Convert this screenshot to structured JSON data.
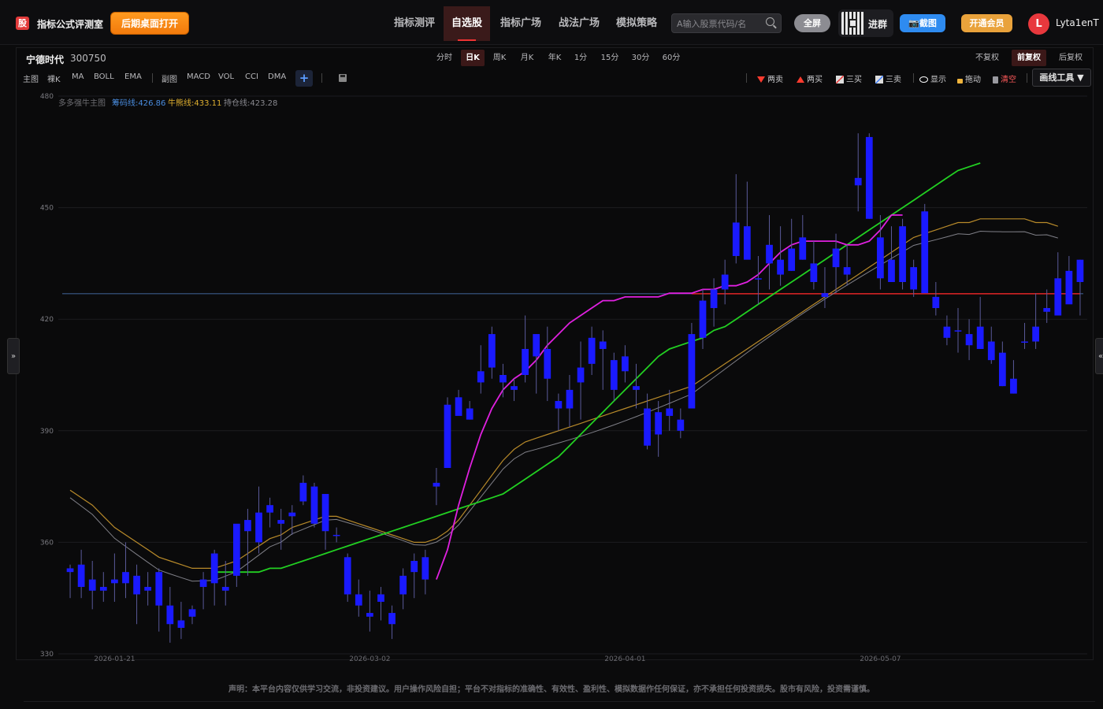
{
  "app": {
    "logo_char": "股",
    "title": "指标公式评测室",
    "open_desktop_label": "后期桌面打开"
  },
  "nav": {
    "items": [
      {
        "label": "指标测评",
        "active": false
      },
      {
        "label": "自选股",
        "active": true
      },
      {
        "label": "指标广场",
        "active": false
      },
      {
        "label": "战法广场",
        "active": false
      },
      {
        "label": "模拟策略",
        "active": false
      }
    ],
    "search_placeholder": "A输入股票代码/名",
    "fullscreen_label": "全屏",
    "group_label": "进群",
    "screenshot_label": "📷截图",
    "vip_label": "开通会员",
    "avatar_letter": "L",
    "username": "Lyta1enT"
  },
  "stock": {
    "name": "宁德时代",
    "code": "300750"
  },
  "periods": [
    {
      "label": "分时",
      "active": false
    },
    {
      "label": "日K",
      "active": true
    },
    {
      "label": "周K",
      "active": false
    },
    {
      "label": "月K",
      "active": false
    },
    {
      "label": "年K",
      "active": false
    },
    {
      "label": "1分",
      "active": false
    },
    {
      "label": "15分",
      "active": false
    },
    {
      "label": "30分",
      "active": false
    },
    {
      "label": "60分",
      "active": false
    }
  ],
  "adjust": [
    {
      "label": "不复权",
      "active": false
    },
    {
      "label": "前复权",
      "active": true
    },
    {
      "label": "后复权",
      "active": false
    }
  ],
  "indicators": {
    "main": [
      "主图",
      "裸K",
      "MA",
      "BOLL",
      "EMA"
    ],
    "sub": [
      "副图",
      "MACD",
      "VOL",
      "CCI",
      "DMA"
    ],
    "plus": "+"
  },
  "tools": {
    "sell2": "两卖",
    "buy2": "两买",
    "buy3": "三买",
    "sell3": "三卖",
    "show": "显示",
    "drag": "拖动",
    "clear": "清空",
    "draw_tools": "画线工具 ▼"
  },
  "legend": {
    "title": "多多强牛主图",
    "chip_label": "筹码线:426.86",
    "bull_label": "牛熊线:433.11",
    "hold_label": "持仓线:423.28"
  },
  "colors": {
    "candle_up": "#1a1aff",
    "candle_down": "#1a1aff",
    "wick": "#5a5a9a",
    "magenta_line": "#e020e0",
    "green_line": "#22d022",
    "gold_line": "#b88a2a",
    "gray_line": "#808088",
    "blue_hline": "#3a5a8a",
    "red_hline": "#e02020"
  },
  "chart_data": {
    "type": "candlestick",
    "ylim": [
      330,
      480
    ],
    "yticks": [
      330,
      360,
      390,
      420,
      450,
      480
    ],
    "xtick_labels": [
      {
        "index": 4,
        "label": "2026-01-21"
      },
      {
        "index": 27,
        "label": "2026-03-02"
      },
      {
        "index": 50,
        "label": "2026-04-01"
      },
      {
        "index": 73,
        "label": "2026-05-07"
      }
    ],
    "chip_line": 426.86,
    "red_line": 426.86,
    "candles": [
      [
        353,
        354,
        345,
        352
      ],
      [
        348,
        358,
        345,
        354
      ],
      [
        350,
        355,
        342,
        347
      ],
      [
        347,
        352,
        344,
        348
      ],
      [
        349,
        357,
        344,
        350
      ],
      [
        352,
        360,
        345,
        349
      ],
      [
        346,
        354,
        338,
        351
      ],
      [
        347,
        352,
        343,
        348
      ],
      [
        352,
        353,
        336,
        343
      ],
      [
        343,
        348,
        333,
        338
      ],
      [
        339,
        344,
        334,
        337
      ],
      [
        342,
        343,
        338,
        340
      ],
      [
        350,
        352,
        342,
        348
      ],
      [
        349,
        358,
        343,
        357
      ],
      [
        347,
        355,
        343,
        348
      ],
      [
        351,
        363,
        348,
        365
      ],
      [
        366,
        369,
        351,
        363
      ],
      [
        368,
        375,
        357,
        360
      ],
      [
        370,
        372,
        364,
        368
      ],
      [
        366,
        369,
        358,
        365
      ],
      [
        368,
        370,
        362,
        367
      ],
      [
        376,
        378,
        370,
        371
      ],
      [
        375,
        376,
        364,
        365
      ],
      [
        373,
        373,
        358,
        363
      ],
      [
        362,
        364,
        360,
        362
      ],
      [
        356,
        357,
        344,
        346
      ],
      [
        346,
        350,
        340,
        343
      ],
      [
        341,
        347,
        336,
        340
      ],
      [
        344,
        348,
        339,
        346
      ],
      [
        341,
        343,
        334,
        338
      ],
      [
        351,
        353,
        342,
        346
      ],
      [
        352,
        357,
        345,
        355
      ],
      [
        356,
        358,
        346,
        350
      ],
      [
        376,
        380,
        370,
        375
      ],
      [
        397,
        399,
        380,
        380
      ],
      [
        399,
        401,
        395,
        394
      ],
      [
        396,
        398,
        393,
        393
      ],
      [
        403,
        413,
        400,
        406
      ],
      [
        407,
        418,
        404,
        416
      ],
      [
        405,
        408,
        399,
        403
      ],
      [
        402,
        404,
        398,
        401
      ],
      [
        412,
        421,
        403,
        405
      ],
      [
        410,
        416,
        400,
        416
      ],
      [
        412,
        418,
        398,
        404
      ],
      [
        398,
        400,
        390,
        396
      ],
      [
        401,
        405,
        391,
        396
      ],
      [
        403,
        414,
        393,
        407
      ],
      [
        415,
        418,
        405,
        408
      ],
      [
        412,
        417,
        401,
        414
      ],
      [
        409,
        411,
        398,
        401
      ],
      [
        410,
        413,
        403,
        406
      ],
      [
        402,
        408,
        396,
        401
      ],
      [
        396,
        400,
        385,
        386
      ],
      [
        395,
        398,
        383,
        389
      ],
      [
        396,
        401,
        390,
        394
      ],
      [
        393,
        396,
        388,
        390
      ],
      [
        416,
        419,
        396,
        396
      ],
      [
        425,
        428,
        412,
        415
      ],
      [
        428,
        431,
        418,
        423
      ],
      [
        432,
        436,
        424,
        428
      ],
      [
        446,
        459,
        435,
        437
      ],
      [
        445,
        457,
        440,
        436
      ],
      [
        431,
        437,
        424,
        431
      ],
      [
        440,
        448,
        428,
        435
      ],
      [
        436,
        445,
        429,
        432
      ],
      [
        439,
        447,
        433,
        433
      ],
      [
        442,
        448,
        436,
        436
      ],
      [
        435,
        441,
        428,
        430
      ],
      [
        426,
        434,
        423,
        427
      ],
      [
        439,
        443,
        427,
        434
      ],
      [
        432,
        440,
        429,
        434
      ],
      [
        458,
        470,
        449,
        456
      ],
      [
        469,
        470,
        447,
        447
      ],
      [
        442,
        448,
        428,
        431
      ],
      [
        436,
        445,
        431,
        430
      ],
      [
        445,
        447,
        428,
        430
      ],
      [
        428,
        436,
        426,
        434
      ],
      [
        449,
        451,
        428,
        427
      ],
      [
        426,
        430,
        421,
        423
      ],
      [
        418,
        421,
        413,
        415
      ],
      [
        417,
        423,
        411,
        417
      ],
      [
        416,
        420,
        409,
        413
      ],
      [
        418,
        426,
        412,
        412
      ],
      [
        414,
        418,
        408,
        409
      ],
      [
        411,
        414,
        402,
        402
      ],
      [
        404,
        409,
        400,
        400
      ],
      [
        414,
        419,
        412,
        414
      ],
      [
        418,
        427,
        412,
        414
      ],
      [
        422,
        428,
        419,
        423
      ],
      [
        431,
        438,
        424,
        421
      ],
      [
        433,
        437,
        425,
        424
      ],
      [
        436,
        436,
        421,
        430
      ]
    ],
    "series": [
      {
        "name": "magenta",
        "start": 33,
        "values": [
          350,
          358,
          370,
          380,
          389,
          396,
          401,
          404,
          406,
          409,
          413,
          416,
          419,
          421,
          423,
          425,
          425,
          426,
          426,
          426,
          426,
          427,
          427,
          427,
          428,
          428,
          429,
          429,
          430,
          432,
          435,
          438,
          440,
          441,
          441,
          441,
          441,
          440,
          440,
          441,
          444,
          448,
          448
        ]
      },
      {
        "name": "green_full",
        "start": 13,
        "values": [
          352,
          352,
          352,
          352,
          352,
          353,
          353,
          354,
          355,
          356,
          357,
          358,
          359,
          360,
          361,
          362,
          363,
          364,
          365,
          366,
          367,
          368,
          369,
          370,
          371,
          372,
          373,
          375,
          377,
          379,
          381,
          383,
          386,
          389,
          392,
          395,
          398,
          401,
          404,
          407,
          410,
          412,
          413,
          414,
          415,
          417,
          418,
          420,
          422,
          424,
          426,
          428,
          430,
          432,
          434,
          436,
          438,
          440,
          442,
          444,
          446,
          448,
          450,
          452,
          454,
          456,
          458,
          460,
          461,
          462
        ]
      },
      {
        "name": "gold",
        "start": 0,
        "values": [
          374,
          372,
          370,
          367,
          364,
          362,
          360,
          358,
          356,
          355,
          354,
          353,
          353,
          353,
          354,
          355,
          357,
          359,
          361,
          362,
          364,
          365,
          366,
          367,
          367,
          366,
          365,
          364,
          363,
          362,
          361,
          360,
          360,
          361,
          363,
          366,
          370,
          374,
          378,
          382,
          385,
          387,
          388,
          389,
          390,
          391,
          392,
          393,
          394,
          395,
          396,
          397,
          398,
          399,
          400,
          401,
          402,
          404,
          406,
          408,
          410,
          412,
          414,
          416,
          418,
          420,
          422,
          424,
          426,
          428,
          430,
          432,
          434,
          436,
          438,
          440,
          442,
          443,
          444,
          445,
          446,
          446,
          447,
          447,
          447,
          447,
          447,
          446,
          446,
          445
        ]
      }
    ]
  },
  "disclaimer": "声明：本平台内容仅供学习交流，非投资建议。用户操作风险自担；平台不对指标的准确性、有效性、盈利性、模拟数据作任何保证，亦不承担任何投资损失。股市有风险，投资需谨慎。"
}
